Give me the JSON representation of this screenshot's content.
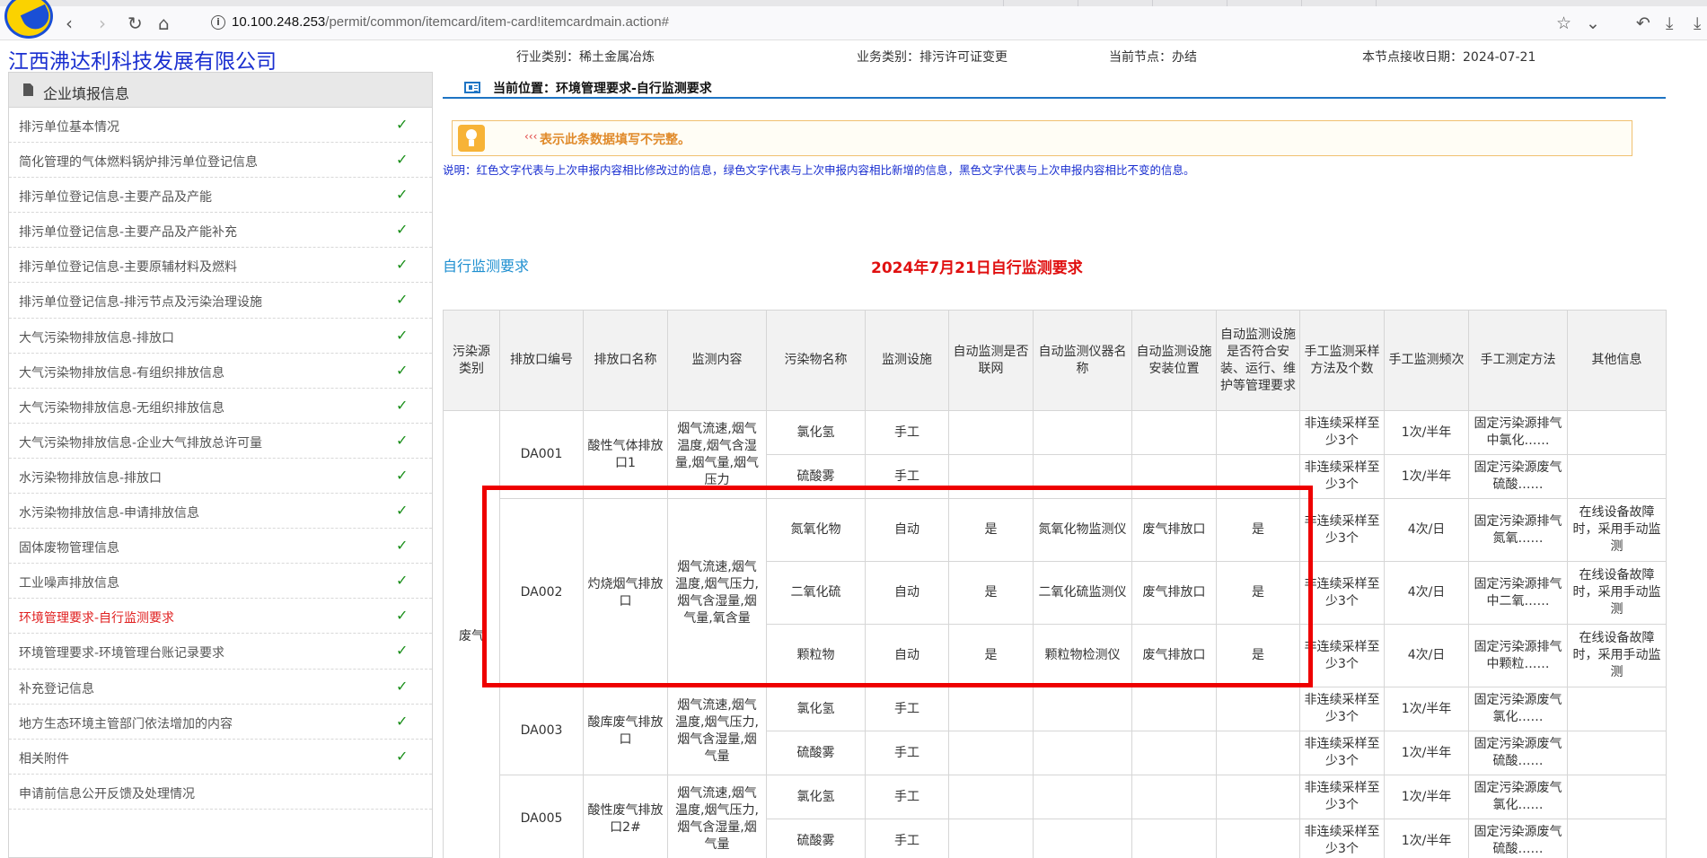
{
  "browser": {
    "url_host": "10.100.248.253",
    "url_path": "/permit/common/itemcard/item-card!itemcardmain.action#",
    "back_icon": "‹",
    "forward_icon": "›",
    "reload_icon": "↻",
    "home_icon": "⌂",
    "info_icon": "i",
    "bookmark_icon": "☆",
    "dropdown_icon": "⌄",
    "history_icon": "↶",
    "download_icon": "⤓",
    "downloads_icon": "⤓"
  },
  "header": {
    "company": "江西沸达利科技发展有限公司",
    "industry": "行业类别：稀土金属冶炼",
    "business": "业务类别：排污许可证变更",
    "node": "当前节点：办结",
    "date": "本节点接收日期：2024-07-21"
  },
  "sidebar": {
    "title": "企业填报信息",
    "check_glyph": "✓",
    "items": [
      {
        "label": "排污单位基本情况"
      },
      {
        "label": "简化管理的气体燃料锅炉排污单位登记信息"
      },
      {
        "label": "排污单位登记信息-主要产品及产能"
      },
      {
        "label": "排污单位登记信息-主要产品及产能补充"
      },
      {
        "label": "排污单位登记信息-主要原辅材料及燃料"
      },
      {
        "label": "排污单位登记信息-排污节点及污染治理设施"
      },
      {
        "label": "大气污染物排放信息-排放口"
      },
      {
        "label": "大气污染物排放信息-有组织排放信息"
      },
      {
        "label": "大气污染物排放信息-无组织排放信息"
      },
      {
        "label": "大气污染物排放信息-企业大气排放总许可量"
      },
      {
        "label": "水污染物排放信息-排放口"
      },
      {
        "label": "水污染物排放信息-申请排放信息"
      },
      {
        "label": "固体废物管理信息"
      },
      {
        "label": "工业噪声排放信息"
      },
      {
        "label": "环境管理要求-自行监测要求"
      },
      {
        "label": "环境管理要求-环境管理台账记录要求"
      },
      {
        "label": "补充登记信息"
      },
      {
        "label": "地方生态环境主管部门依法增加的内容"
      },
      {
        "label": "相关附件"
      },
      {
        "label": "申请前信息公开反馈及处理情况"
      }
    ]
  },
  "main": {
    "breadcrumb": "当前位置：环境管理要求-自行监测要求",
    "notice_arrows": "‹‹‹",
    "notice": "表示此条数据填写不完整。",
    "explain": "说明：红色文字代表与上次申报内容相比修改过的信息，绿色文字代表与上次申报内容相比新增的信息，黑色文字代表与上次申报内容相比不变的信息。",
    "section_label": "自行监测要求",
    "table_title": "2024年7月21日自行监测要求",
    "columns": [
      "污染源类别",
      "排放口编号",
      "排放口名称",
      "监测内容",
      "污染物名称",
      "监测设施",
      "自动监测是否联网",
      "自动监测仪器名称",
      "自动监测设施安装位置",
      "自动监测设施是否符合安装、运行、维护等管理要求",
      "手工监测采样方法及个数",
      "手工监测频次",
      "手工测定方法",
      "其他信息"
    ],
    "source_category": "废气",
    "outlets": [
      {
        "code": "DA001",
        "name": "酸性气体排放口1",
        "content": "烟气流速,烟气温度,烟气含湿量,烟气量,烟气压力",
        "rows": [
          {
            "pollutant": "氯化氢",
            "facility": "手工",
            "networked": "",
            "instrument": "",
            "location": "",
            "compliant": "",
            "sampling": "非连续采样至少3个",
            "freq": "1次/半年",
            "method": "固定污染源排气中氯化……",
            "other": ""
          },
          {
            "pollutant": "硫酸雾",
            "facility": "手工",
            "networked": "",
            "instrument": "",
            "location": "",
            "compliant": "",
            "sampling": "非连续采样至少3个",
            "freq": "1次/半年",
            "method": "固定污染源废气硫酸……",
            "other": ""
          }
        ]
      },
      {
        "code": "DA002",
        "name": "灼烧烟气排放口",
        "content": "烟气流速,烟气温度,烟气压力,烟气含湿量,烟气量,氧含量",
        "rows": [
          {
            "pollutant": "氮氧化物",
            "facility": "自动",
            "networked": "是",
            "instrument": "氮氧化物监测仪",
            "location": "废气排放口",
            "compliant": "是",
            "sampling": "非连续采样至少3个",
            "freq": "4次/日",
            "method": "固定污染源排气氮氧……",
            "other": "在线设备故障时，采用手动监测"
          },
          {
            "pollutant": "二氧化硫",
            "facility": "自动",
            "networked": "是",
            "instrument": "二氧化硫监测仪",
            "location": "废气排放口",
            "compliant": "是",
            "sampling": "非连续采样至少3个",
            "freq": "4次/日",
            "method": "固定污染源排气中二氧……",
            "other": "在线设备故障时，采用手动监测"
          },
          {
            "pollutant": "颗粒物",
            "facility": "自动",
            "networked": "是",
            "instrument": "颗粒物检测仪",
            "location": "废气排放口",
            "compliant": "是",
            "sampling": "非连续采样至少3个",
            "freq": "4次/日",
            "method": "固定污染源排气中颗粒……",
            "other": "在线设备故障时，采用手动监测"
          }
        ]
      },
      {
        "code": "DA003",
        "name": "酸库废气排放口",
        "content": "烟气流速,烟气温度,烟气压力,烟气含湿量,烟气量",
        "rows": [
          {
            "pollutant": "氯化氢",
            "facility": "手工",
            "networked": "",
            "instrument": "",
            "location": "",
            "compliant": "",
            "sampling": "非连续采样至少3个",
            "freq": "1次/半年",
            "method": "固定污染源废气氯化……",
            "other": ""
          },
          {
            "pollutant": "硫酸雾",
            "facility": "手工",
            "networked": "",
            "instrument": "",
            "location": "",
            "compliant": "",
            "sampling": "非连续采样至少3个",
            "freq": "1次/半年",
            "method": "固定污染源废气硫酸……",
            "other": ""
          }
        ]
      },
      {
        "code": "DA005",
        "name": "酸性废气排放口2#",
        "content": "烟气流速,烟气温度,烟气压力,烟气含湿量,烟气量",
        "rows": [
          {
            "pollutant": "氯化氢",
            "facility": "手工",
            "networked": "",
            "instrument": "",
            "location": "",
            "compliant": "",
            "sampling": "非连续采样至少3个",
            "freq": "1次/半年",
            "method": "固定污染源废气氯化……",
            "other": ""
          },
          {
            "pollutant": "硫酸雾",
            "facility": "手工",
            "networked": "",
            "instrument": "",
            "location": "",
            "compliant": "",
            "sampling": "非连续采样至少3个",
            "freq": "1次/半年",
            "method": "固定污染源废气硫酸……",
            "other": ""
          }
        ]
      }
    ]
  },
  "colors": {
    "company": "#1a2fd0",
    "active_menu": "#e02020",
    "check": "#1a8f1a",
    "table_title": "#e01010",
    "highlight_box": "#ee0000",
    "breadcrumb_line": "#1e74c4"
  }
}
